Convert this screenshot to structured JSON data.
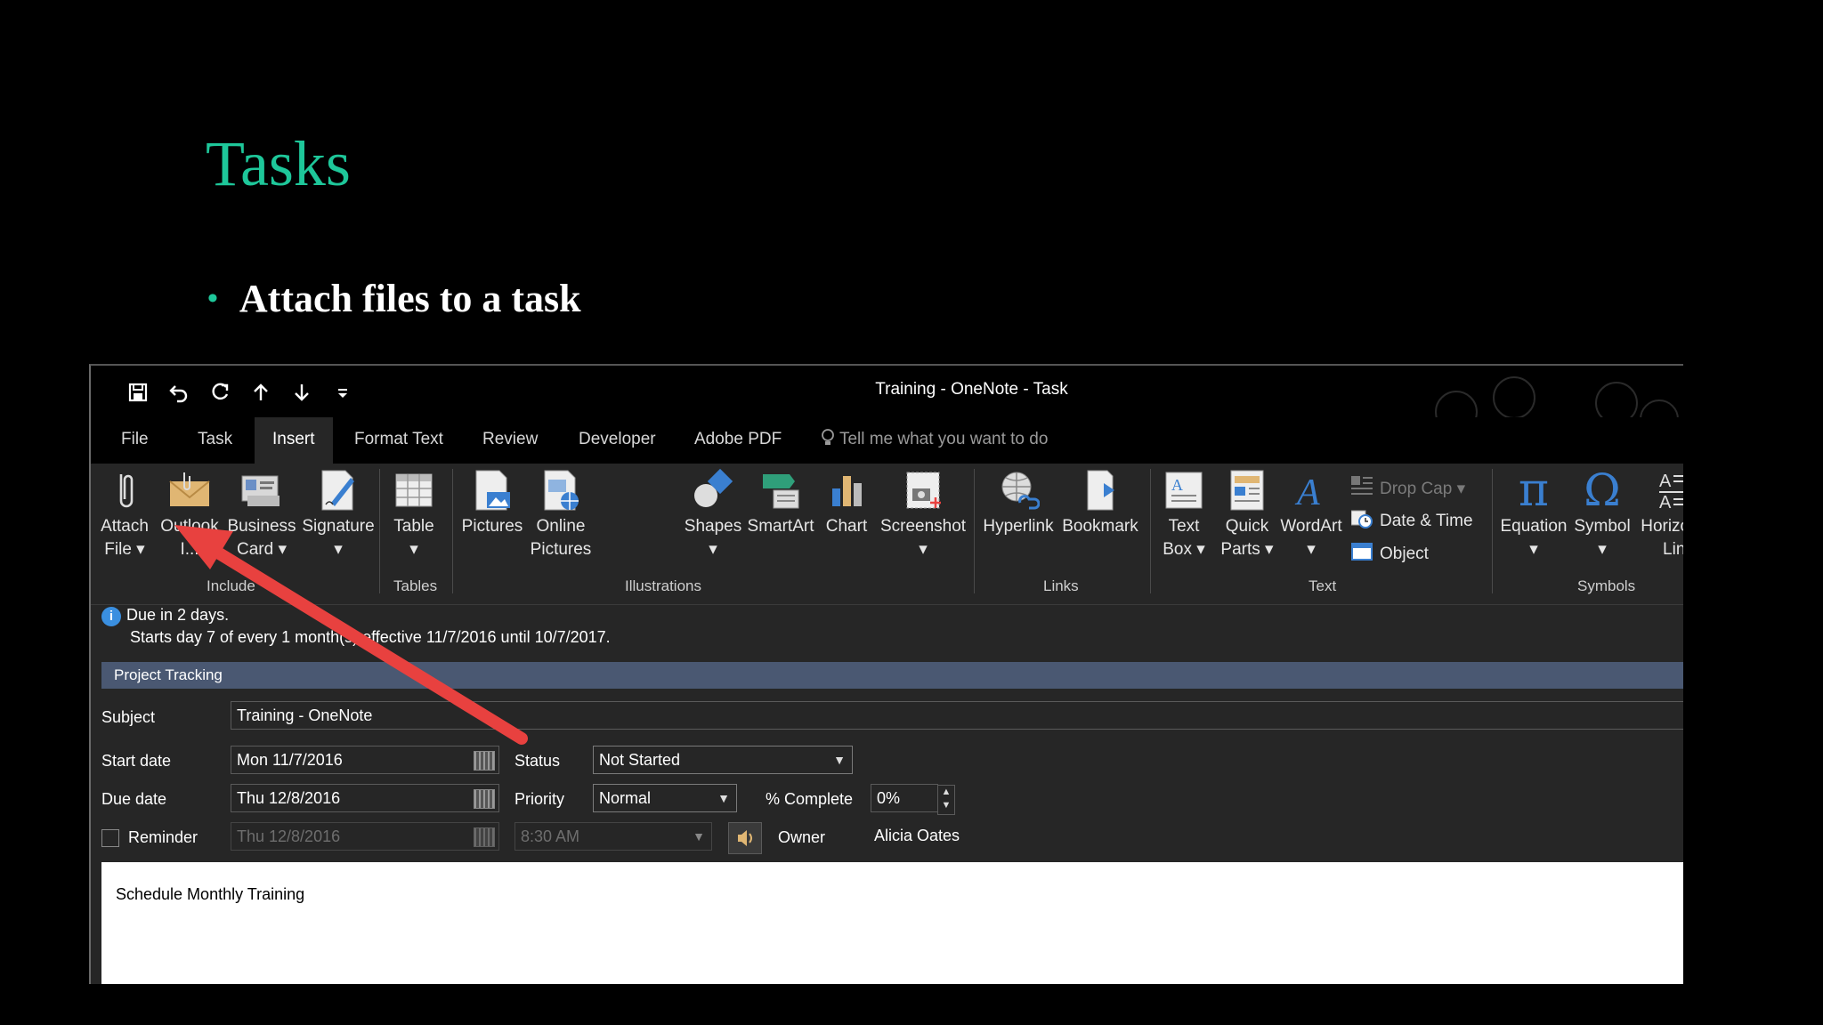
{
  "slide": {
    "title": "Tasks",
    "bullet": "Attach files to a task"
  },
  "window": {
    "title": "Training - OneNote - Task",
    "qat": [
      {
        "name": "save-icon",
        "glyph": "💾"
      },
      {
        "name": "undo-icon",
        "glyph": "↶"
      },
      {
        "name": "redo-icon",
        "glyph": "↻"
      },
      {
        "name": "up-arrow-icon",
        "glyph": "↑"
      },
      {
        "name": "down-arrow-icon",
        "glyph": "↓"
      },
      {
        "name": "customize-qat-icon",
        "glyph": "⩡"
      }
    ]
  },
  "tabs": {
    "file": "File",
    "task": "Task",
    "insert": "Insert",
    "format_text": "Format Text",
    "review": "Review",
    "developer": "Developer",
    "adobe_pdf": "Adobe PDF",
    "tell_me": "Tell me what you want to do",
    "active": "Insert"
  },
  "ribbon": {
    "attach_file": [
      "Attach",
      "File ▾"
    ],
    "outlook_item": [
      "Outlook",
      "I..."
    ],
    "business_card": [
      "Business",
      "Card ▾"
    ],
    "signature": [
      "Signature",
      "▾"
    ],
    "include_label": "Include",
    "table": [
      "Table",
      "▾"
    ],
    "tables_label": "Tables",
    "pictures": [
      "Pictures"
    ],
    "online_pictures": [
      "Online",
      "Pictures"
    ],
    "shapes": [
      "Shapes",
      "▾"
    ],
    "smartart": [
      "SmartArt"
    ],
    "chart": [
      "Chart"
    ],
    "screenshot": [
      "Screenshot",
      "▾"
    ],
    "illustrations_label": "Illustrations",
    "hyperlink": [
      "Hyperlink"
    ],
    "bookmark": [
      "Bookmark"
    ],
    "links_label": "Links",
    "text_box": [
      "Text",
      "Box ▾"
    ],
    "quick_parts": [
      "Quick",
      "Parts ▾"
    ],
    "wordart": [
      "WordArt",
      "▾"
    ],
    "drop_cap": "Drop Cap ▾",
    "date_time": "Date & Time",
    "object": "Object",
    "text_label": "Text",
    "equation": [
      "Equation",
      "▾"
    ],
    "symbol": [
      "Symbol",
      "▾"
    ],
    "horizontal_line": [
      "Horizontal",
      "Line"
    ],
    "symbols_label": "Symbols"
  },
  "info": {
    "line1": "Due in 2 days.",
    "line2": "Starts day 7 of every 1 month(s) effective 11/7/2016 until 10/7/2017."
  },
  "section": "Project Tracking",
  "form": {
    "subject_label": "Subject",
    "subject_value": "Training - OneNote",
    "start_label": "Start date",
    "start_value": "Mon 11/7/2016",
    "due_label": "Due date",
    "due_value": "Thu 12/8/2016",
    "reminder_label": "Reminder",
    "reminder_date": "Thu 12/8/2016",
    "reminder_time": "8:30 AM",
    "status_label": "Status",
    "status_value": "Not Started",
    "priority_label": "Priority",
    "priority_value": "Normal",
    "complete_label": "% Complete",
    "complete_value": "0%",
    "owner_label": "Owner",
    "owner_value": "Alicia Oates"
  },
  "notes": "Schedule Monthly Training",
  "colors": {
    "accent": "#1ec79a",
    "arrow": "#e8413f",
    "section_bar": "#4a5872"
  }
}
